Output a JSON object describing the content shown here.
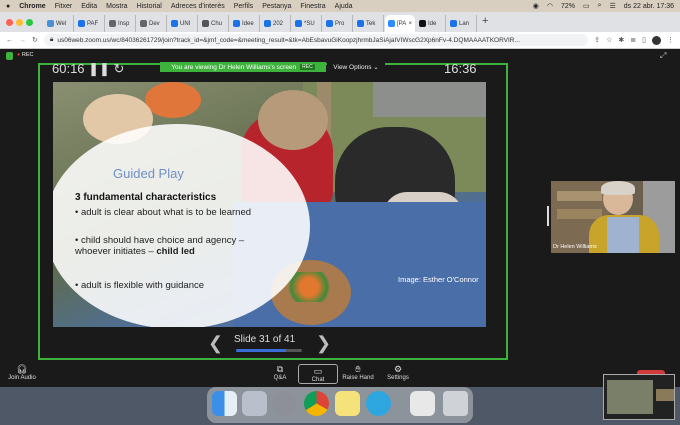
{
  "menubar": {
    "app": "Chrome",
    "items": [
      "Fitxer",
      "Edita",
      "Mostra",
      "Historial",
      "Adreces d'interès",
      "Perfils",
      "Pestanya",
      "Finestra",
      "Ajuda"
    ],
    "battery": "72%",
    "datetime": "ds 22 abr.  17:36"
  },
  "tabs": [
    {
      "label": "Wel",
      "color": "#4a90d9"
    },
    {
      "label": "PAF",
      "color": "#1a73e8"
    },
    {
      "label": "Insp",
      "color": "#666"
    },
    {
      "label": "Dev",
      "color": "#666"
    },
    {
      "label": "UNI",
      "color": "#1a73e8"
    },
    {
      "label": "Chu",
      "color": "#555"
    },
    {
      "label": "Idee",
      "color": "#1a73e8"
    },
    {
      "label": "202",
      "color": "#1a73e8"
    },
    {
      "label": "*SU",
      "color": "#1a73e8"
    },
    {
      "label": "Pro",
      "color": "#1a73e8"
    },
    {
      "label": "Tek",
      "color": "#1a73e8"
    },
    {
      "label": "[PA",
      "color": "#2d8cff"
    },
    {
      "label": "Ide",
      "color": "#111"
    },
    {
      "label": "Lan",
      "color": "#1a73e8"
    }
  ],
  "address": {
    "url": "us06web.zoom.us/wc/84036261729/join?track_id=&jmf_code=&meeting_result=&tk=AbEsbavuGiKoopzjhrmbJaSiAjaIVIWscG2Xp6nFv-4.DQMAAAATKORVIR..."
  },
  "zoom": {
    "rec_label": "REC",
    "viewing_text": "You are viewing Dr Helen Williams's screen",
    "viewing_rec": "REC",
    "view_options": "View Options ⌄",
    "timer_left": "60:16 ❚❚ ↻",
    "timer_right": "16:36"
  },
  "slide": {
    "title": "Guided Play",
    "subtitle": "3 fundamental characteristics",
    "bullets": [
      "adult is clear about what is to be learned",
      "child should have choice and agency – whoever initiates –",
      "adult is flexible with guidance"
    ],
    "bullet2_bold": "child led",
    "credit": "Image: Esther O'Connor"
  },
  "slide_nav": {
    "prev": "❮",
    "count": "Slide 31 of 41",
    "next": "❯",
    "progress": 0.756
  },
  "participant": {
    "name": "Dr Helen Williams"
  },
  "zoom_tools": {
    "join_audio": "Join Audio",
    "qa": "Q&A",
    "chat": "Chat",
    "raise_hand": "Raise Hand",
    "settings": "Settings"
  },
  "colors": {
    "share_border": "#3db33d",
    "title_blue": "#6f8fc7",
    "progress": "#3b6fd6"
  }
}
